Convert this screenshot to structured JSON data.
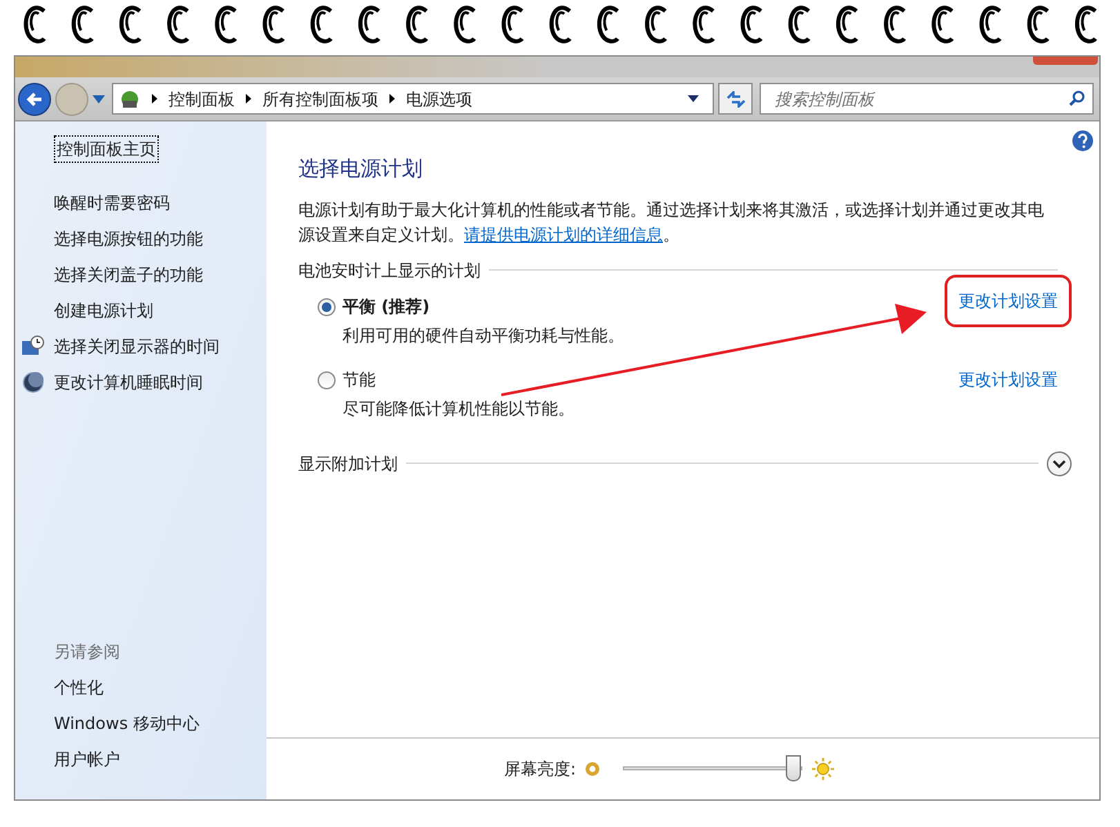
{
  "address_bar": {
    "breadcrumbs": [
      "控制面板",
      "所有控制面板项",
      "电源选项"
    ]
  },
  "search": {
    "placeholder": "搜索控制面板"
  },
  "sidebar": {
    "home": "控制面板主页",
    "items": [
      {
        "label": "唤醒时需要密码",
        "kind": "plain"
      },
      {
        "label": "选择电源按钮的功能",
        "kind": "plain"
      },
      {
        "label": "选择关闭盖子的功能",
        "kind": "plain"
      },
      {
        "label": "创建电源计划",
        "kind": "plain"
      },
      {
        "label": "选择关闭显示器的时间",
        "kind": "monitor"
      },
      {
        "label": "更改计算机睡眠时间",
        "kind": "sleep"
      }
    ],
    "see_also": {
      "title": "另请参阅",
      "items": [
        "个性化",
        "Windows 移动中心",
        "用户帐户"
      ]
    }
  },
  "main": {
    "title": "选择电源计划",
    "description": "电源计划有助于最大化计算机的性能或者节能。通过选择计划来将其激活，或选择计划并通过更改其电源设置来自定义计划。",
    "link": "请提供电源计划的详细信息",
    "link_after": "。",
    "group_label": "电池安时计上显示的计划",
    "plans": [
      {
        "name": "平衡 (推荐)",
        "description": "利用可用的硬件自动平衡功耗与性能。",
        "selected": true,
        "action": "更改计划设置",
        "highlighted": true
      },
      {
        "name": "节能",
        "description": "尽可能降低计算机性能以节能。",
        "selected": false,
        "action": "更改计划设置",
        "highlighted": false
      }
    ],
    "more": "显示附加计划"
  },
  "brightness": {
    "label": "屏幕亮度:",
    "level": 0.95
  }
}
